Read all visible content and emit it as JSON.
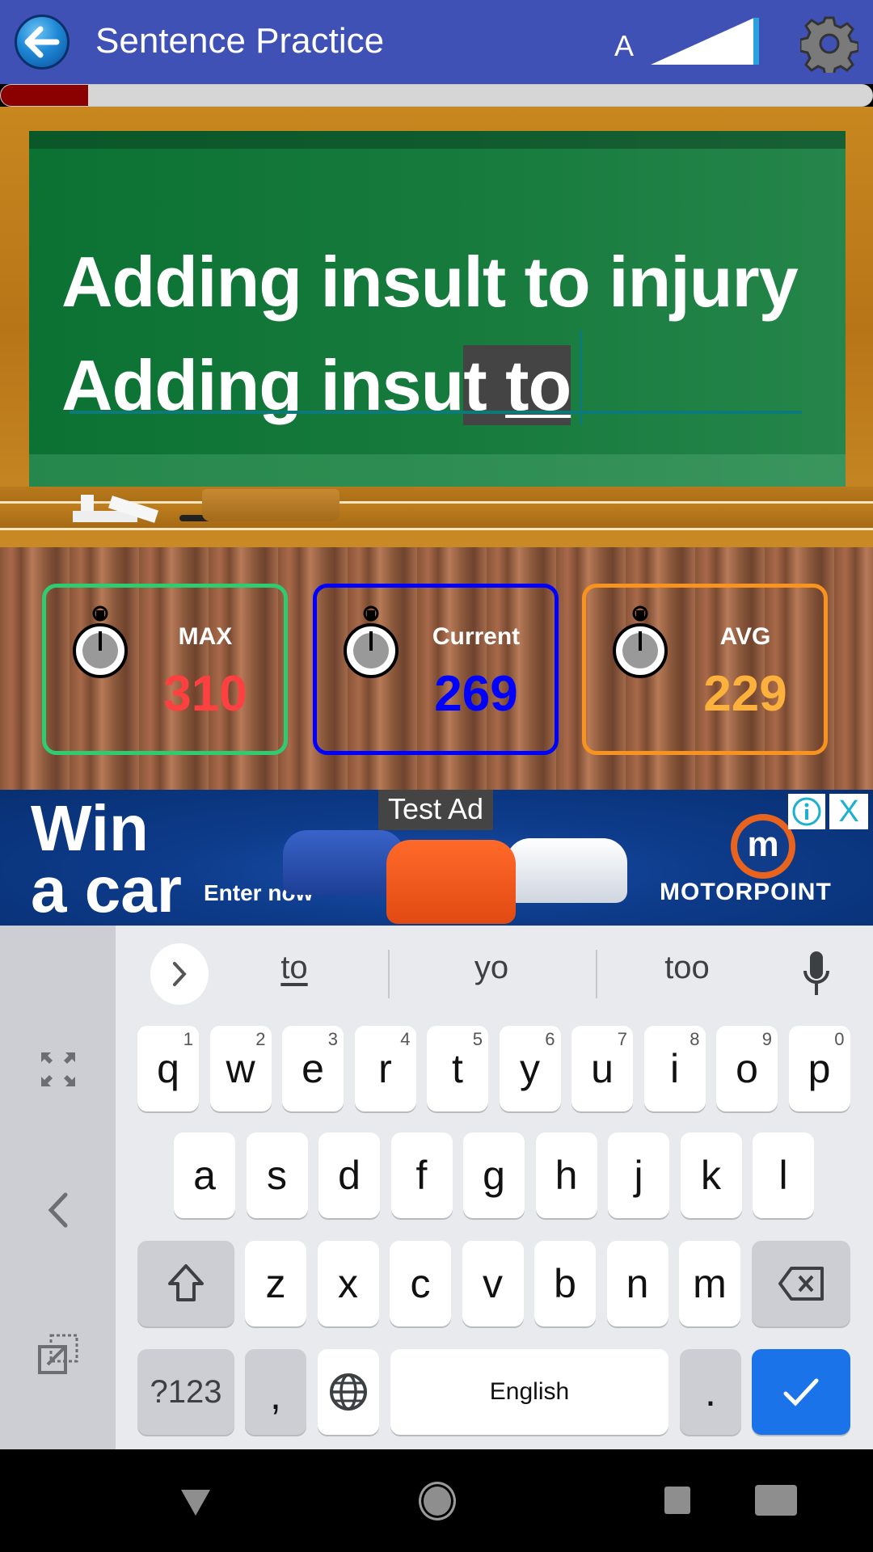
{
  "app": {
    "title": "Sentence Practice",
    "font_size_label": "A",
    "font_size_level": 1.0,
    "progress_fraction": 0.1
  },
  "board": {
    "target_sentence": "Adding insult to injury",
    "typed_correct": "Adding insu",
    "typed_error": "t ",
    "typed_current_word": "to"
  },
  "stats": [
    {
      "label": "MAX",
      "value": "310",
      "color": "#ff4040",
      "border": "#2ecc71"
    },
    {
      "label": "Current",
      "value": "269",
      "color": "#0000ff",
      "border": "#0000ff"
    },
    {
      "label": "AVG",
      "value": "229",
      "color": "#fbb13c",
      "border": "#f7931e"
    }
  ],
  "ad": {
    "badge": "Test Ad",
    "headline_line1": "Win",
    "headline_line2": "a car",
    "cta": "Enter now",
    "logo_letter": "m",
    "brand": "MOTORPOINT",
    "info_icon": "info-icon",
    "close_label": "X"
  },
  "keyboard": {
    "suggestions": [
      "to",
      "yo",
      "too"
    ],
    "row1": [
      {
        "k": "q",
        "h": "1"
      },
      {
        "k": "w",
        "h": "2"
      },
      {
        "k": "e",
        "h": "3"
      },
      {
        "k": "r",
        "h": "4"
      },
      {
        "k": "t",
        "h": "5"
      },
      {
        "k": "y",
        "h": "6"
      },
      {
        "k": "u",
        "h": "7"
      },
      {
        "k": "i",
        "h": "8"
      },
      {
        "k": "o",
        "h": "9"
      },
      {
        "k": "p",
        "h": "0"
      }
    ],
    "row2": [
      "a",
      "s",
      "d",
      "f",
      "g",
      "h",
      "j",
      "k",
      "l"
    ],
    "row3": [
      "z",
      "x",
      "c",
      "v",
      "b",
      "n",
      "m"
    ],
    "symbols_label": "?123",
    "comma_label": ",",
    "space_label": "English",
    "period_label": ".",
    "accent_color": "#1a73e8"
  }
}
